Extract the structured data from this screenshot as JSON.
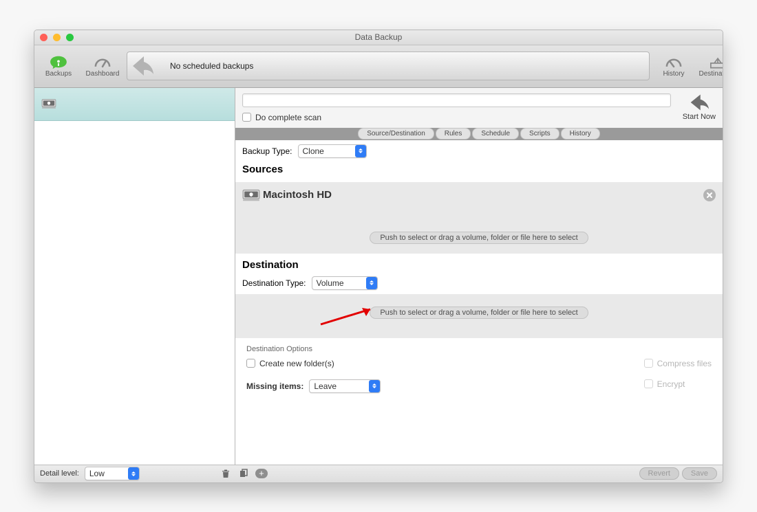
{
  "window": {
    "title": "Data Backup"
  },
  "toolbar": {
    "left": [
      {
        "name": "backups",
        "label": "Backups"
      },
      {
        "name": "dashboard",
        "label": "Dashboard"
      }
    ],
    "right": [
      {
        "name": "history",
        "label": "History"
      },
      {
        "name": "destinations",
        "label": "Destinations"
      }
    ],
    "banner_text": "No scheduled backups"
  },
  "top": {
    "name_value": "",
    "complete_scan_label": "Do complete scan",
    "start_label": "Start Now"
  },
  "tabs": [
    "Source/Destination",
    "Rules",
    "Schedule",
    "Scripts",
    "History"
  ],
  "backup_type": {
    "label": "Backup Type:",
    "value": "Clone"
  },
  "sources": {
    "heading": "Sources",
    "items": [
      {
        "name": "Macintosh HD"
      }
    ],
    "drop_hint": "Push to select or drag a volume, folder or file here to select"
  },
  "destination": {
    "heading": "Destination",
    "type_label": "Destination Type:",
    "type_value": "Volume",
    "drop_hint": "Push to select or drag a volume, folder or file here to select"
  },
  "dest_options": {
    "legend": "Destination Options",
    "create_folder": "Create new folder(s)",
    "missing_items_label": "Missing items:",
    "missing_items_value": "Leave",
    "compress": "Compress files",
    "encrypt": "Encrypt"
  },
  "bottom": {
    "detail_label": "Detail level:",
    "detail_value": "Low",
    "revert": "Revert",
    "save": "Save"
  }
}
